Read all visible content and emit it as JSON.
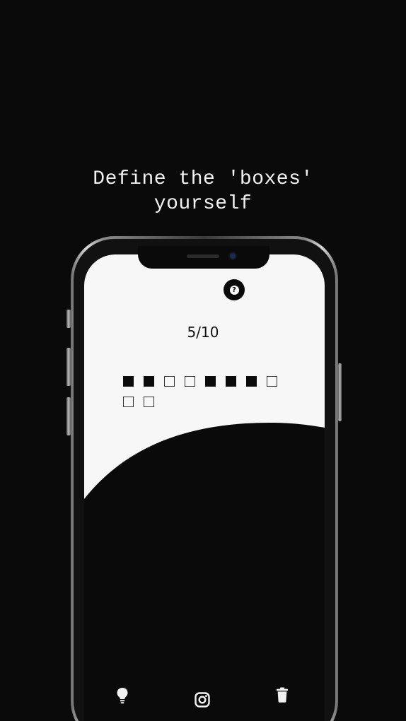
{
  "headline": {
    "line1": "Define the 'boxes'",
    "line2": "yourself"
  },
  "screen": {
    "progress": "5/10",
    "boxes": [
      "filled",
      "filled",
      "empty",
      "empty",
      "filled",
      "filled",
      "filled",
      "empty",
      "empty",
      "empty"
    ],
    "help_icon": "question-mark-icon"
  },
  "bottom_bar": {
    "icons": [
      "lightbulb-icon",
      "instagram-icon",
      "trash-icon"
    ]
  },
  "colors": {
    "background": "#0a0a0a",
    "screen": "#f7f7f7",
    "text_light": "#f2f2f2"
  }
}
